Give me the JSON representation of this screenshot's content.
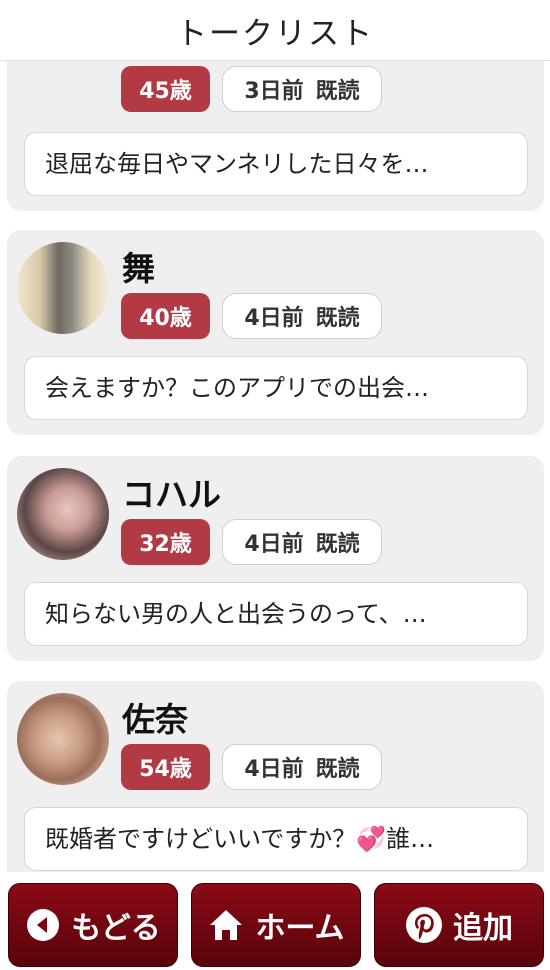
{
  "header": {
    "title": "トークリスト"
  },
  "items": [
    {
      "name": "",
      "age": "45歳",
      "time": "3日前",
      "read": "既読",
      "message": "退屈な毎日やマンネリした日々を…",
      "has_heart": false
    },
    {
      "name": "舞",
      "age": "40歳",
      "time": "4日前",
      "read": "既読",
      "message": "会えますか？このアプリでの出会…",
      "has_heart": false
    },
    {
      "name": "コハル",
      "age": "32歳",
      "time": "4日前",
      "read": "既読",
      "message": "知らない男の人と出会うのって、…",
      "has_heart": false
    },
    {
      "name": "佐奈",
      "age": "54歳",
      "time": "4日前",
      "read": "既読",
      "message_before": "既婚者ですけどいいですか？",
      "message_after": "誰…",
      "has_heart": true
    }
  ],
  "bottom_nav": {
    "back_label": "もどる",
    "home_label": "ホーム",
    "add_label": "追加"
  },
  "colors": {
    "age_badge": "#b23a44",
    "nav_button": "#7a0712",
    "card_bg": "#efefef"
  },
  "icons": {
    "back": "chevron-left-circle-icon",
    "home": "home-icon",
    "add": "pinterest-icon",
    "heart": "two-hearts-icon"
  }
}
